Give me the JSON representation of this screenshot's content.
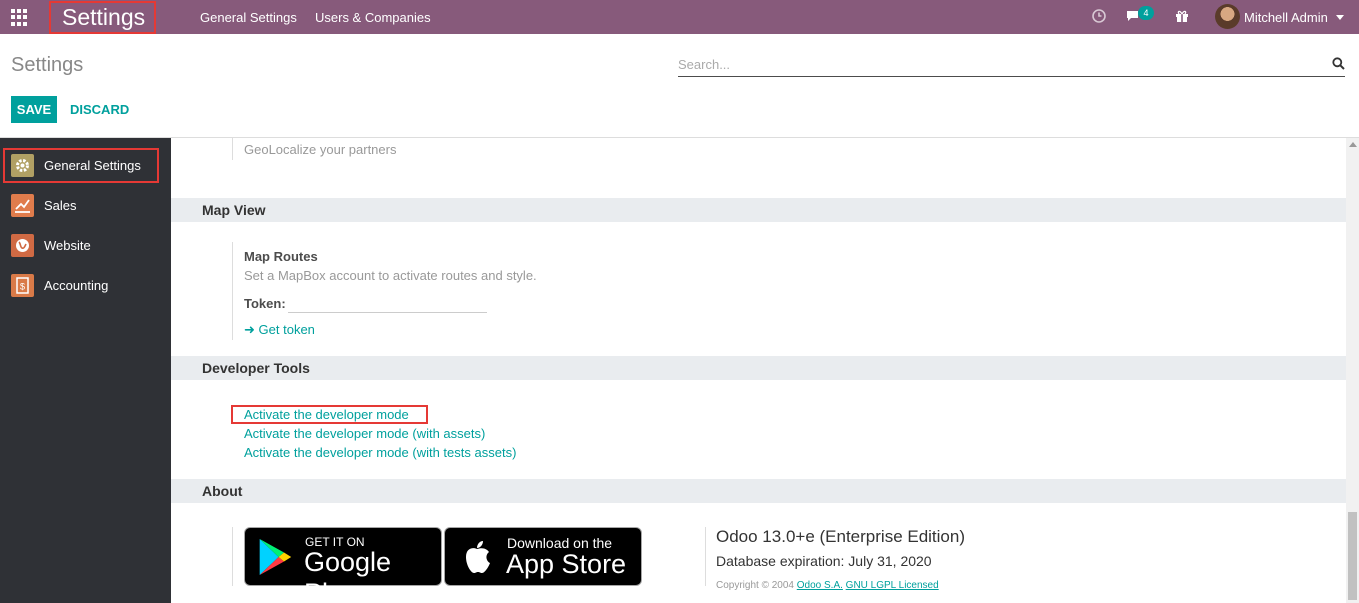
{
  "topbar": {
    "app_title": "Settings",
    "menu": [
      "General Settings",
      "Users & Companies"
    ],
    "messages_count": "4",
    "user_name": "Mitchell Admin"
  },
  "control_panel": {
    "title": "Settings",
    "search_placeholder": "Search...",
    "save_label": "SAVE",
    "discard_label": "DISCARD"
  },
  "sidebar": {
    "items": [
      {
        "label": "General Settings",
        "icon": "gear-icon",
        "color": "#b1a064"
      },
      {
        "label": "Sales",
        "icon": "chart-icon",
        "color": "#e07c4c"
      },
      {
        "label": "Website",
        "icon": "globe-icon",
        "color": "#d06a44"
      },
      {
        "label": "Accounting",
        "icon": "invoice-icon",
        "color": "#d97a48"
      }
    ]
  },
  "content": {
    "geolocalize_text": "GeoLocalize your partners",
    "map_view": {
      "heading": "Map View",
      "routes_title": "Map Routes",
      "routes_desc": "Set a MapBox account to activate routes and style.",
      "token_label": "Token:",
      "get_token": "Get token"
    },
    "developer_tools": {
      "heading": "Developer Tools",
      "links": [
        "Activate the developer mode",
        "Activate the developer mode (with assets)",
        "Activate the developer mode (with tests assets)"
      ]
    },
    "about": {
      "heading": "About",
      "google_small": "GET IT ON",
      "google_big": "Google Play",
      "apple_small": "Download on the",
      "apple_big": "App Store",
      "version": "Odoo 13.0+e (Enterprise Edition)",
      "expiration": "Database expiration: July 31, 2020",
      "copyright_prefix": "Copyright © 2004 ",
      "company_link": "Odoo S.A.",
      "license_link": "GNU LGPL Licensed"
    }
  },
  "colors": {
    "brand": "#875a7b",
    "accent": "#00a09d",
    "highlight_box": "#e53935"
  }
}
